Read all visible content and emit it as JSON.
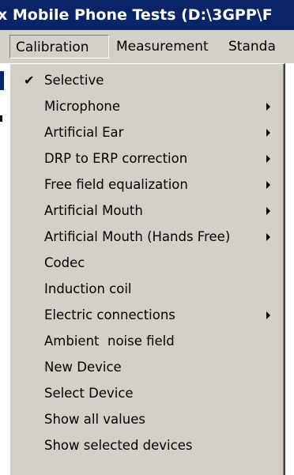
{
  "window": {
    "title": "x Mobile Phone Tests (D:\\3GPP\\F"
  },
  "menubar": {
    "items": [
      "Calibration",
      "Measurement",
      "Standa"
    ]
  },
  "menu": {
    "items": [
      {
        "label": "Selective",
        "checked": true,
        "submenu": false
      },
      {
        "label": "Microphone",
        "checked": false,
        "submenu": true
      },
      {
        "label": "Artificial Ear",
        "checked": false,
        "submenu": true
      },
      {
        "label": "DRP to ERP correction",
        "checked": false,
        "submenu": true
      },
      {
        "label": "Free field equalization",
        "checked": false,
        "submenu": true
      },
      {
        "label": "Artificial Mouth",
        "checked": false,
        "submenu": true
      },
      {
        "label": "Artificial Mouth (Hands Free)",
        "checked": false,
        "submenu": true
      },
      {
        "label": "Codec",
        "checked": false,
        "submenu": false
      },
      {
        "label": "Induction coil",
        "checked": false,
        "submenu": false
      },
      {
        "label": "Electric connections",
        "checked": false,
        "submenu": true
      },
      {
        "label": "Ambient  noise field",
        "checked": false,
        "submenu": false
      },
      {
        "label": "New Device",
        "checked": false,
        "submenu": false
      },
      {
        "label": "Select Device",
        "checked": false,
        "submenu": false
      },
      {
        "label": "Show all values",
        "checked": false,
        "submenu": false
      },
      {
        "label": "Show selected devices",
        "checked": false,
        "submenu": false
      }
    ],
    "check_glyph": "✔"
  },
  "colors": {
    "titlebar_bg": "#0a246a",
    "menu_bg": "#d4d0c8"
  }
}
